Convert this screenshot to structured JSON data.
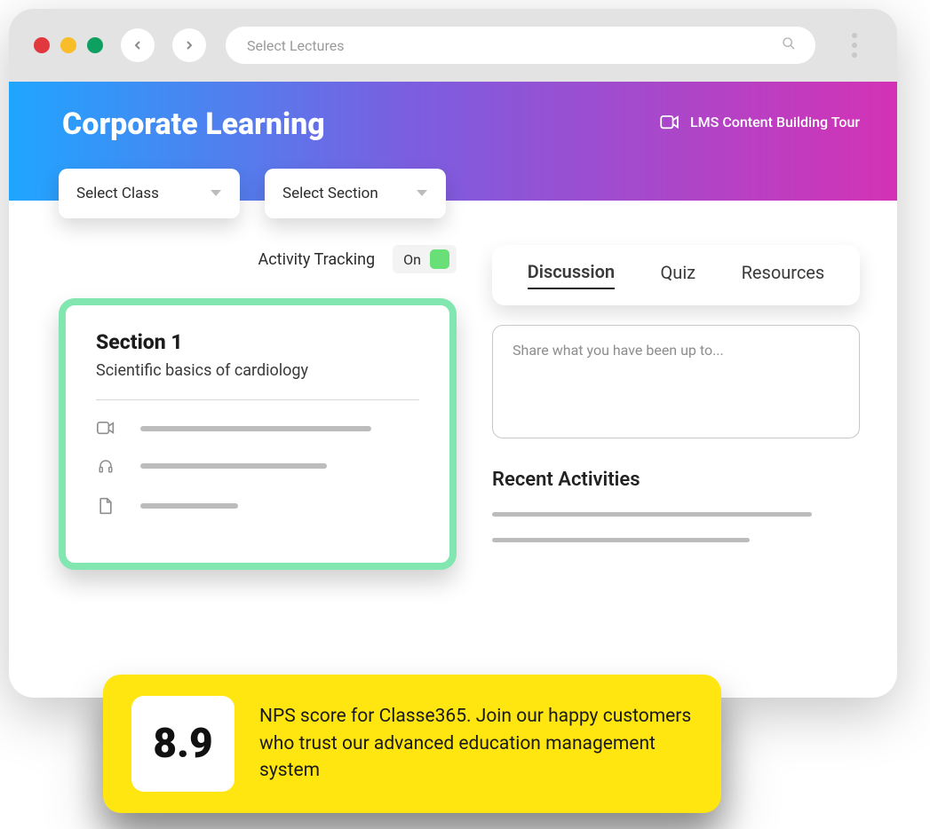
{
  "titlebar": {
    "search_placeholder": "Select Lectures"
  },
  "header": {
    "title": "Corporate Learning",
    "tour_label": "LMS Content Building Tour"
  },
  "selects": {
    "class": "Select Class",
    "section": "Select Section"
  },
  "activity": {
    "label": "Activity Tracking",
    "toggle": "On"
  },
  "section_card": {
    "title": "Section 1",
    "subtitle": "Scientific basics of cardiology"
  },
  "tabs": {
    "discussion": "Discussion",
    "quiz": "Quiz",
    "resources": "Resources"
  },
  "post": {
    "placeholder": "Share what you have been up to..."
  },
  "recent": {
    "title": "Recent Activities"
  },
  "promo": {
    "score": "8.9",
    "text": "NPS score for Classe365. Join our happy customers who trust our advanced education management system"
  }
}
